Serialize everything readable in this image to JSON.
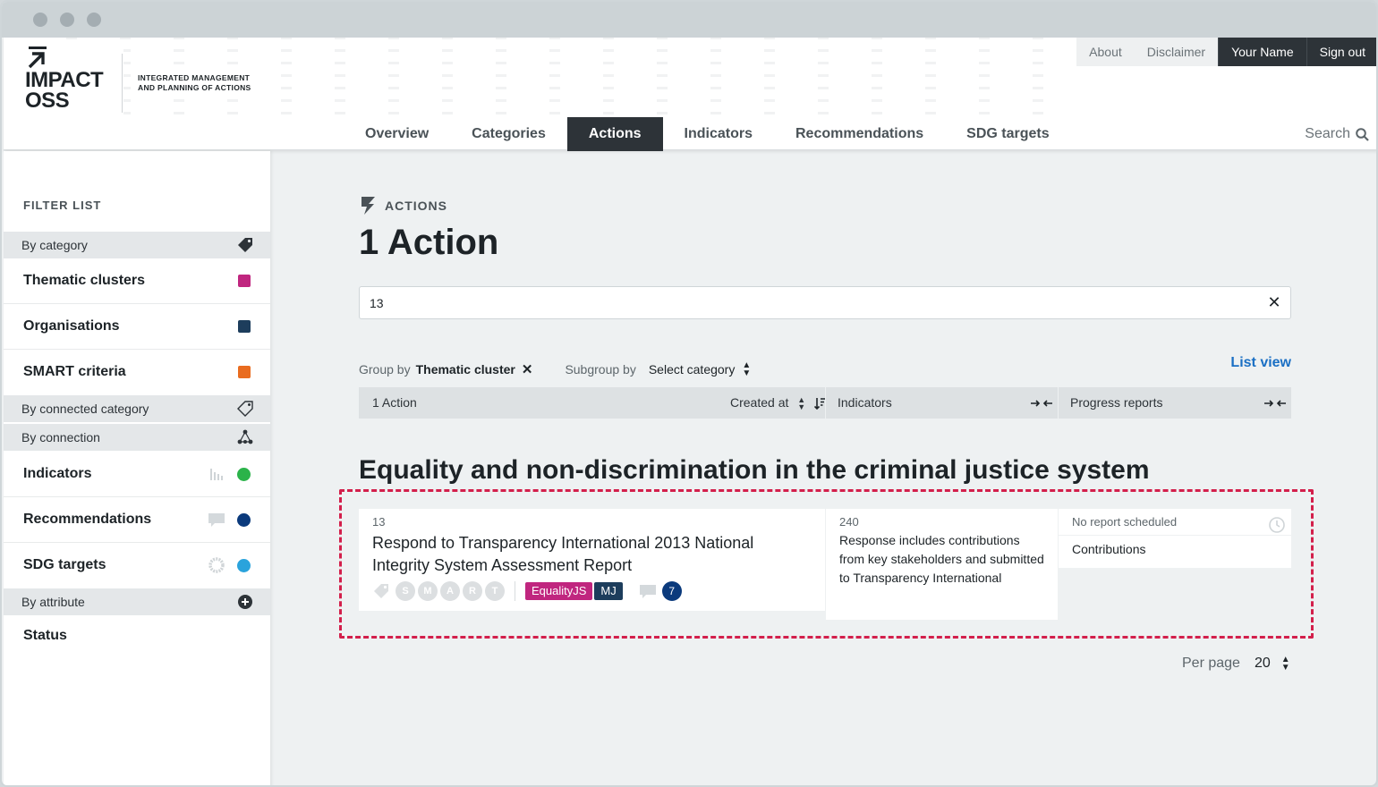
{
  "app": {
    "logo_line1": "IMPACT",
    "logo_line2": "OSS",
    "claim_line1": "INTEGRATED MANAGEMENT",
    "claim_line2": "AND PLANNING OF ACTIONS"
  },
  "topnav": {
    "about": "About",
    "disclaimer": "Disclaimer",
    "user": "Your Name",
    "signout": "Sign out"
  },
  "mainnav": {
    "items": [
      "Overview",
      "Categories",
      "Actions",
      "Indicators",
      "Recommendations",
      "SDG targets"
    ],
    "active": "Actions",
    "search": "Search"
  },
  "sidebar": {
    "title": "FILTER LIST",
    "by_category": "By category",
    "thematic": "Thematic clusters",
    "organisations": "Organisations",
    "smart": "SMART criteria",
    "by_connected": "By connected category",
    "by_connection": "By connection",
    "indicators": "Indicators",
    "recommendations": "Recommendations",
    "sdg": "SDG targets",
    "by_attribute": "By attribute",
    "status": "Status",
    "colors": {
      "thematic": "#c0267f",
      "organisations": "#1d3d5c",
      "smart": "#e96c1f",
      "indicators": "#2bb34a",
      "recommendations": "#0b3a7c",
      "sdg": "#2aa3dc"
    }
  },
  "main": {
    "section_label": "ACTIONS",
    "title": "1 Action",
    "search_value": "13",
    "group_label": "Group by",
    "group_value": "Thematic cluster",
    "subgroup_label": "Subgroup by",
    "subgroup_value": "Select category",
    "list_view": "List view",
    "header": {
      "count": "1 Action",
      "created": "Created at",
      "indicators": "Indicators",
      "progress": "Progress reports"
    },
    "cluster": "Equality and non-discrimination in the criminal justice system",
    "action": {
      "ref": "13",
      "title": "Respond to Transparency International 2013 National Integrity System Assessment Report",
      "smart": [
        "S",
        "M",
        "A",
        "R",
        "T"
      ],
      "tags": [
        {
          "label": "EqualityJS",
          "color": "#c0267f"
        },
        {
          "label": "MJ",
          "color": "#1d3d5c"
        }
      ],
      "comments": "7"
    },
    "indicator": {
      "ref": "240",
      "text": "Response includes contributions from key stakeholders and submitted to Transparency International"
    },
    "report": {
      "status": "No report scheduled",
      "item": "Contributions"
    },
    "per_page_label": "Per page",
    "per_page_value": "20"
  }
}
